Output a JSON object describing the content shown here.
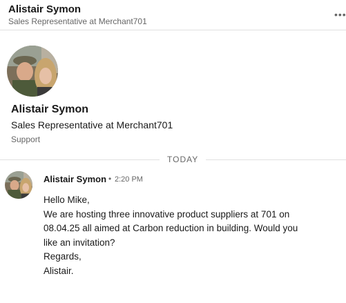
{
  "header": {
    "name": "Alistair Symon",
    "title": "Sales Representative at Merchant701",
    "more_icon": "more-horizontal-icon"
  },
  "profile": {
    "name": "Alistair Symon",
    "title": "Sales Representative at Merchant701",
    "department": "Support"
  },
  "divider": {
    "label": "TODAY"
  },
  "message": {
    "sender": "Alistair Symon",
    "separator": "•",
    "time": "2:20 PM",
    "lines": [
      "Hello Mike,",
      "We are hosting three innovative product suppliers at 701 on",
      "08.04.25 all aimed at Carbon reduction in building. Would you",
      "like an invitation?",
      "Regards,",
      "Alistair."
    ]
  }
}
